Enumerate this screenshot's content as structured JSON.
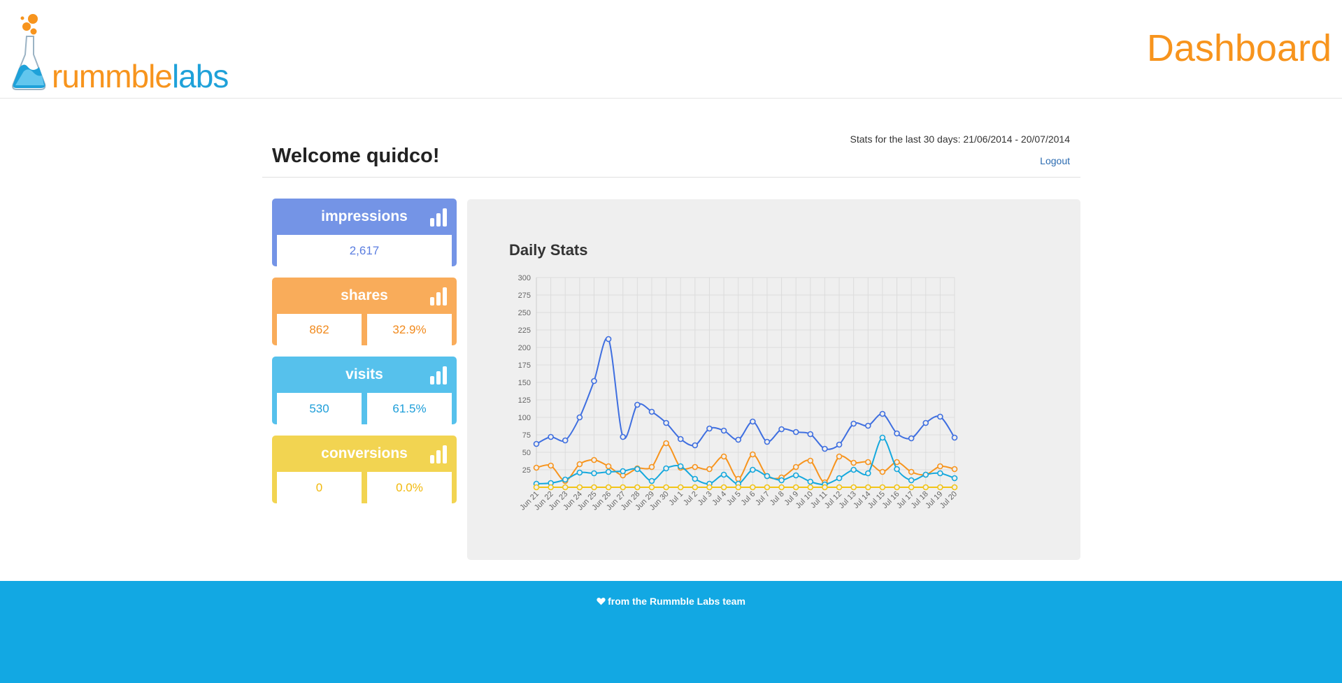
{
  "header": {
    "logo_part1": "rummble",
    "logo_part2": "labs",
    "title": "Dashboard"
  },
  "welcome": "Welcome quidco!",
  "stats_range": "Stats for the last 30 days: 21/06/2014 - 20/07/2014",
  "logout_label": "Logout",
  "cards": [
    {
      "label": "impressions",
      "values": [
        "2,617"
      ],
      "color": "#7494e6",
      "text_color": "#5b7ee0"
    },
    {
      "label": "shares",
      "values": [
        "862",
        "32.9%"
      ],
      "color": "#f9ac5a",
      "text_color": "#f18a1d"
    },
    {
      "label": "visits",
      "values": [
        "530",
        "61.5%"
      ],
      "color": "#56c1ec",
      "text_color": "#1d9ed9"
    },
    {
      "label": "conversions",
      "values": [
        "0",
        "0.0%"
      ],
      "color": "#f2d451",
      "text_color": "#f2b90c"
    }
  ],
  "footer": {
    "text": "from the Rummble Labs team",
    "icon": "heart-icon"
  },
  "chart_data": {
    "type": "line",
    "title": "Daily Stats",
    "xlabel": "",
    "ylabel": "",
    "ylim": [
      0,
      300
    ],
    "yticks": [
      25,
      50,
      75,
      100,
      125,
      150,
      175,
      200,
      225,
      250,
      275,
      300
    ],
    "grid": true,
    "categories": [
      "Jun 21",
      "Jun 22",
      "Jun 23",
      "Jun 24",
      "Jun 25",
      "Jun 26",
      "Jun 27",
      "Jun 28",
      "Jun 29",
      "Jun 30",
      "Jul 1",
      "Jul 2",
      "Jul 3",
      "Jul 4",
      "Jul 5",
      "Jul 6",
      "Jul 7",
      "Jul 8",
      "Jul 9",
      "Jul 10",
      "Jul 11",
      "Jul 12",
      "Jul 13",
      "Jul 14",
      "Jul 15",
      "Jul 16",
      "Jul 17",
      "Jul 18",
      "Jul 19",
      "Jul 20"
    ],
    "series": [
      {
        "color": "#3f6fe0",
        "values": [
          62,
          72,
          67,
          100,
          152,
          212,
          72,
          118,
          108,
          92,
          69,
          60,
          84,
          81,
          68,
          94,
          65,
          83,
          79,
          76,
          55,
          61,
          91,
          88,
          105,
          77,
          70,
          92,
          101,
          71
        ]
      },
      {
        "color": "#f7941d",
        "values": [
          28,
          31,
          9,
          33,
          39,
          30,
          17,
          27,
          29,
          63,
          28,
          29,
          26,
          44,
          12,
          47,
          16,
          14,
          29,
          38,
          7,
          44,
          35,
          36,
          22,
          36,
          22,
          18,
          30,
          26
        ]
      },
      {
        "color": "#15a8dd",
        "values": [
          5,
          6,
          11,
          21,
          20,
          22,
          23,
          26,
          9,
          27,
          30,
          12,
          5,
          18,
          5,
          25,
          16,
          10,
          17,
          8,
          4,
          13,
          25,
          20,
          71,
          26,
          10,
          18,
          20,
          13
        ]
      },
      {
        "color": "#f2c417",
        "values": [
          0,
          0,
          0,
          0,
          0,
          0,
          0,
          0,
          0,
          0,
          0,
          0,
          0,
          0,
          0,
          0,
          0,
          0,
          0,
          0,
          0,
          0,
          0,
          0,
          0,
          0,
          0,
          0,
          0,
          0
        ]
      }
    ]
  }
}
